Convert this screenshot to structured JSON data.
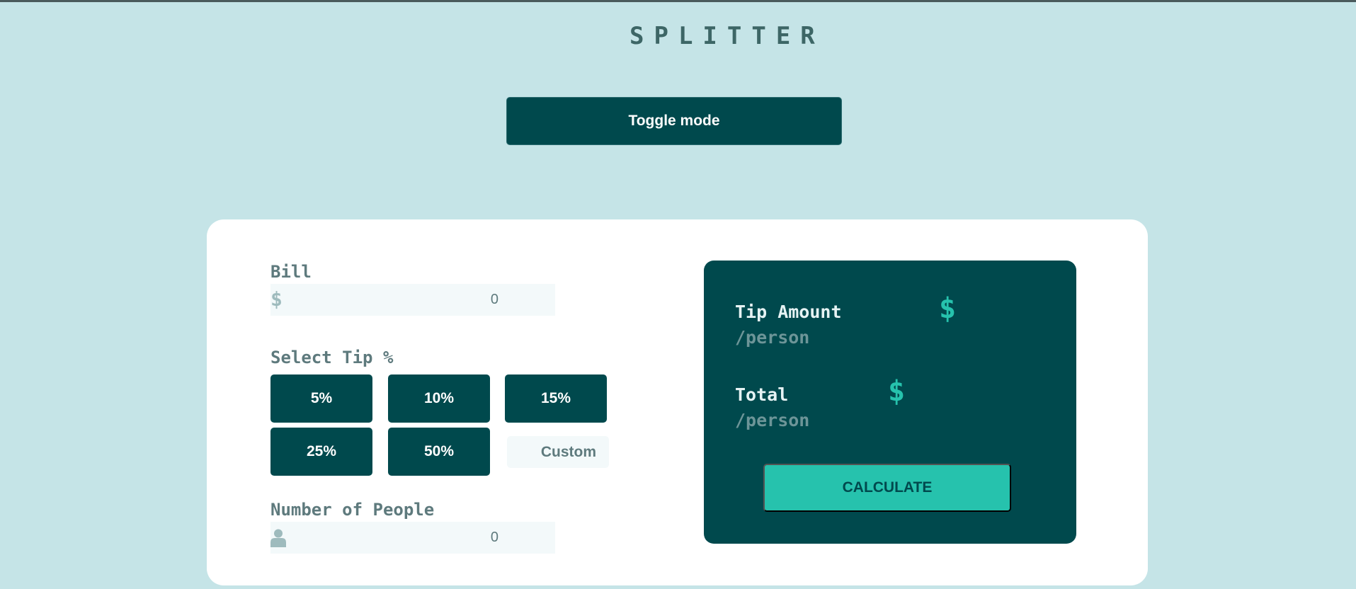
{
  "header": {
    "logo": "SPLITTER",
    "toggle_label": "Toggle mode"
  },
  "bill": {
    "label": "Bill",
    "currency_symbol": "$",
    "value": "0"
  },
  "tip": {
    "label": "Select Tip %",
    "options": [
      "5%",
      "10%",
      "15%",
      "25%",
      "50%"
    ],
    "custom_label": "Custom"
  },
  "people": {
    "label": "Number of People",
    "icon": "person-icon",
    "value": "0"
  },
  "results": {
    "tip_amount_label": "Tip Amount",
    "tip_amount_sub": "/person",
    "tip_amount_symbol": "$",
    "total_label": "Total",
    "total_sub": "/person",
    "total_symbol": "$",
    "calculate_label": "CALCULATE"
  },
  "colors": {
    "background": "#c5e4e7",
    "dark_teal": "#00494d",
    "accent": "#26c2ad",
    "card": "#ffffff",
    "input_bg": "#f3f9fa"
  }
}
